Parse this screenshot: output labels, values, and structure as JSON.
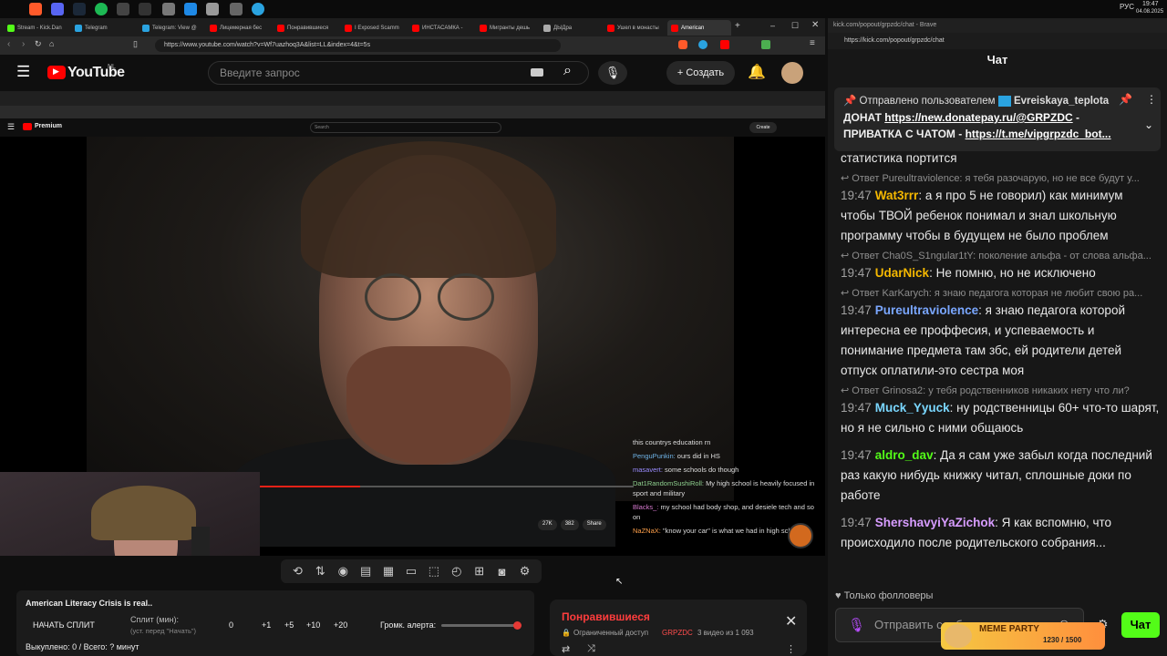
{
  "taskbar": {
    "time": "19:47",
    "date": "04.08.2025",
    "lang": "РУС"
  },
  "tabs": [
    "Stream - Kick.Dan",
    "Telegram",
    "Telegram: View @",
    "Лицемерная бес",
    "Понравившиеся",
    "I Exposed Scamm",
    "ИНСТАСАМКА -",
    "Мигранты дешь",
    "ДЫДра",
    "Ушел в монасты",
    "American"
  ],
  "address": {
    "url": "https://www.youtube.com/watch?v=Wf7uazhoq3A&list=LL&index=4&t=5s"
  },
  "youtube": {
    "logo": "YouTube",
    "region": "NL",
    "search_placeholder": "Введите запрос",
    "create": "Создать"
  },
  "inner": {
    "logo": "Premium",
    "search": "Search",
    "create": "Create"
  },
  "video_chat": [
    {
      "user": "",
      "text": "this countrys education rn"
    },
    {
      "user": "PenguPunkin:",
      "text": "ours did in HS"
    },
    {
      "user": "masavert:",
      "text": "some schools do though"
    },
    {
      "user": "Dat1RandomSushiRoll:",
      "text": "My high school is heavily focused in sport and military"
    },
    {
      "user": "Blacks_:",
      "text": "my school had body shop, and desiele tech and so on"
    },
    {
      "user": "NaZNaX:",
      "text": "\"know your car\" is what we had in high school."
    }
  ],
  "video_stats": {
    "likes": "27K",
    "comments": "382",
    "share": "Share"
  },
  "split": {
    "title": "American Literacy Crisis is real..",
    "start": "НАЧАТЬ СПЛИТ",
    "split_label": "Сплит (мин):",
    "split_hint": "(уст. перед \"Начать\")",
    "value": "0",
    "steps": [
      "+1",
      "+5",
      "+10",
      "+20"
    ],
    "volume": "Громк. алерта:",
    "bought": "Выкуплено: 0 / Всего: ? минут",
    "volume_level": 0.95
  },
  "liked": {
    "title": "Понравившиеся",
    "access": "Ограниченный доступ",
    "owner": "GRPZDC",
    "count": "3 видео из 1 093"
  },
  "kick": {
    "tab": "kick.com/popout/grpzdc/chat - Brave",
    "url": "https://kick.com/popout/grpzdc/chat",
    "title": "Чат"
  },
  "pinned": {
    "label": "Отправлено пользователем",
    "user": "Evreiskaya_teplota",
    "line1a": "ДОНАТ ",
    "line1b": "https://new.donatepay.ru/@GRPZDC",
    "line1c": " -",
    "line2a": "ПРИВАТКА С ЧАТОМ - ",
    "line2b": "https://t.me/vipgrpzdc_bot..."
  },
  "chat": [
    {
      "reply": "",
      "time": "",
      "user": "",
      "text": "статистика портится"
    },
    {
      "reply": "Ответ Pureultraviolence: я тебя разочарую, но не все будут у...",
      "time": "19:47",
      "user": "Wat3rrr",
      "color": "#f5b800",
      "text": "а я про 5 не говорил) как минимум чтобы ТВОЙ ребенок понимал и знал школьную программу чтобы в будущем не было проблем"
    },
    {
      "reply": "Ответ Cha0S_S1ngular1tY: поколение альфа - от слова альфа...",
      "time": "19:47",
      "user": "UdarNick",
      "color": "#f5b800",
      "text": "Не помню, но не исключено"
    },
    {
      "reply": "Ответ KarKarych: я знаю педагога которая не любит свою ра...",
      "time": "19:47",
      "user": "Pureultraviolence",
      "color": "#7aa7ff",
      "text": "я знаю педагога которой интересна ее проффесия, и успеваемость и понимание предмета там збс, ей родители детей отпуск оплатили-это сестра моя"
    },
    {
      "reply": "Ответ Grinosa2: у тебя родственников никаких нету что ли?",
      "time": "19:47",
      "user": "Muck_Yyuck",
      "color": "#7ad7ff",
      "text": "ну родственницы 60+ что-то шарят, но я не сильно с ними общаюсь"
    },
    {
      "reply": "",
      "time": "19:47",
      "user": "aldro_dav",
      "color": "#53fc18",
      "text": "Да я сам уже забыл когда последний раз какую нибудь книжку читал, сплошные доки по работе"
    },
    {
      "reply": "",
      "time": "19:47",
      "user": "ShershavyiYaZichok",
      "color": "#d79cff",
      "text": "Я как вспомню, что происходило после родительского собрания..."
    }
  ],
  "followers": "Только фолловеры",
  "input_placeholder": "Отправить сообщение...",
  "send": "Чат",
  "meme": {
    "label": "MEME PARTY",
    "progress": "1230 / 1500"
  }
}
